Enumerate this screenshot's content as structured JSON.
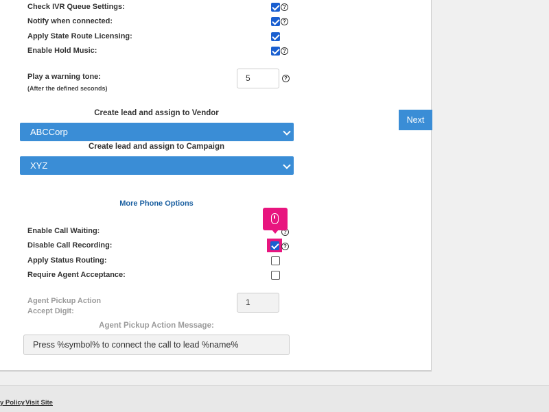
{
  "settings_top": {
    "check_ivr": {
      "label": "Check IVR Queue Settings:"
    },
    "notify": {
      "label": "Notify when connected:"
    },
    "state_route": {
      "label": "Apply State Route Licensing:"
    },
    "hold_music": {
      "label": "Enable Hold Music:"
    }
  },
  "warning_tone": {
    "label": "Play a warning tone:",
    "note": "(After the defined seconds)",
    "value": "5"
  },
  "vendor": {
    "label": "Create lead and assign to Vendor",
    "selected": "ABCCorp"
  },
  "campaign": {
    "label": "Create lead and assign to Campaign",
    "selected": "XYZ"
  },
  "next_button": {
    "label": "Next"
  },
  "more_phone_options": {
    "label": "More Phone Options"
  },
  "phone_options": {
    "call_waiting": {
      "label": "Enable Call Waiting:"
    },
    "call_recording": {
      "label": "Disable Call Recording:"
    },
    "status_routing": {
      "label": "Apply Status Routing:"
    },
    "agent_acceptance": {
      "label": "Require Agent Acceptance:"
    }
  },
  "pickup_digit": {
    "label_line1": "Agent Pickup Action",
    "label_line2": "Accept Digit:",
    "value": "1"
  },
  "pickup_message": {
    "label": "Agent Pickup Action Message:",
    "value": "Press %symbol% to connect the call to lead %name%"
  },
  "help_glyph": "?",
  "footer": {
    "policy_link": "y Policy",
    "visit_link": "Visit Site"
  },
  "colors": {
    "accent": "#3a8dd6",
    "highlight": "#e8157f",
    "link": "#1a5fa0"
  },
  "icons": [
    "help-icon",
    "chevron-down-icon",
    "mouse-icon"
  ]
}
